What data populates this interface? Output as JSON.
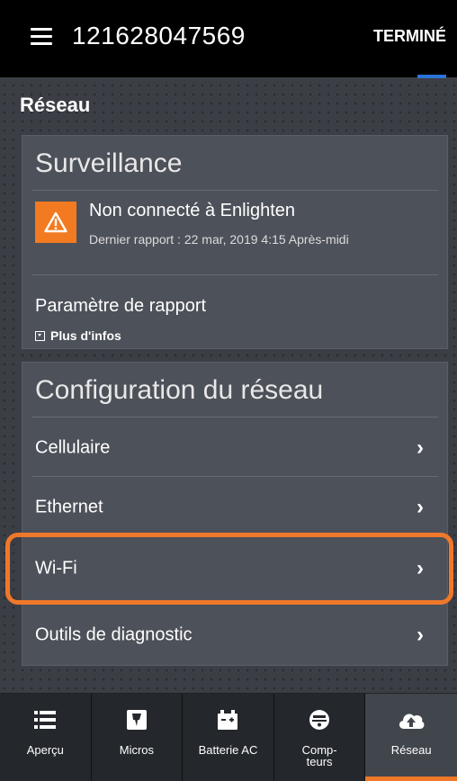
{
  "header": {
    "device_id": "121628047569",
    "done_label": "TERMINÉ"
  },
  "section_title": "Réseau",
  "monitoring": {
    "heading": "Surveillance",
    "status_title": "Non connecté à Enlighten",
    "status_sub": "Dernier rapport : 22 mar, 2019 4:15 Après-midi",
    "report_setting": "Paramètre de rapport",
    "more_info": "Plus d'infos"
  },
  "network_config": {
    "heading": "Configuration du réseau",
    "items": [
      {
        "label": "Cellulaire"
      },
      {
        "label": "Ethernet"
      },
      {
        "label": "Wi-Fi"
      },
      {
        "label": "Outils de diagnostic"
      }
    ]
  },
  "bottom_nav": {
    "tabs": [
      {
        "label": "Aperçu",
        "icon": "list-icon"
      },
      {
        "label": "Micros",
        "icon": "microinverter-icon"
      },
      {
        "label": "Batterie AC",
        "icon": "battery-icon"
      },
      {
        "label": "Comp-\nteurs",
        "icon": "meter-icon"
      },
      {
        "label": "Réseau",
        "icon": "cloud-upload-icon",
        "active": true
      }
    ]
  },
  "colors": {
    "accent_orange": "#f27a21",
    "accent_blue": "#2a73d8",
    "card_bg": "#4d5159"
  }
}
